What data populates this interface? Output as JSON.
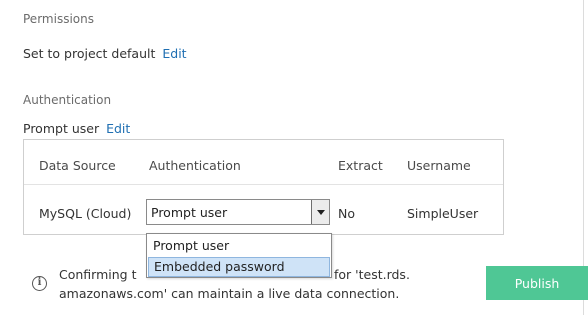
{
  "permissions": {
    "heading": "Permissions",
    "value": "Set to project default",
    "edit": "Edit"
  },
  "authentication": {
    "heading": "Authentication",
    "value": "Prompt user",
    "edit": "Edit",
    "table": {
      "headers": [
        "Data Source",
        "Authentication",
        "Extract",
        "Username"
      ],
      "rows": [
        {
          "data_source": "MySQL (Cloud)",
          "authentication": "Prompt user",
          "extract": "No",
          "username": "SimpleUser"
        }
      ]
    },
    "dropdown_options": [
      "Prompt user",
      "Embedded password"
    ],
    "highlighted_option": "Embedded password"
  },
  "message": {
    "icon": "info-icon",
    "line1_start": "Confirming t",
    "line1_end": "for 'test.rds.",
    "line2": "amazonaws.com' can maintain a live data connection."
  },
  "publish_label": "Publish",
  "colors": {
    "accent": "#4fc795",
    "link": "#1f6fb2",
    "selected_option": "#cfe3f7"
  }
}
